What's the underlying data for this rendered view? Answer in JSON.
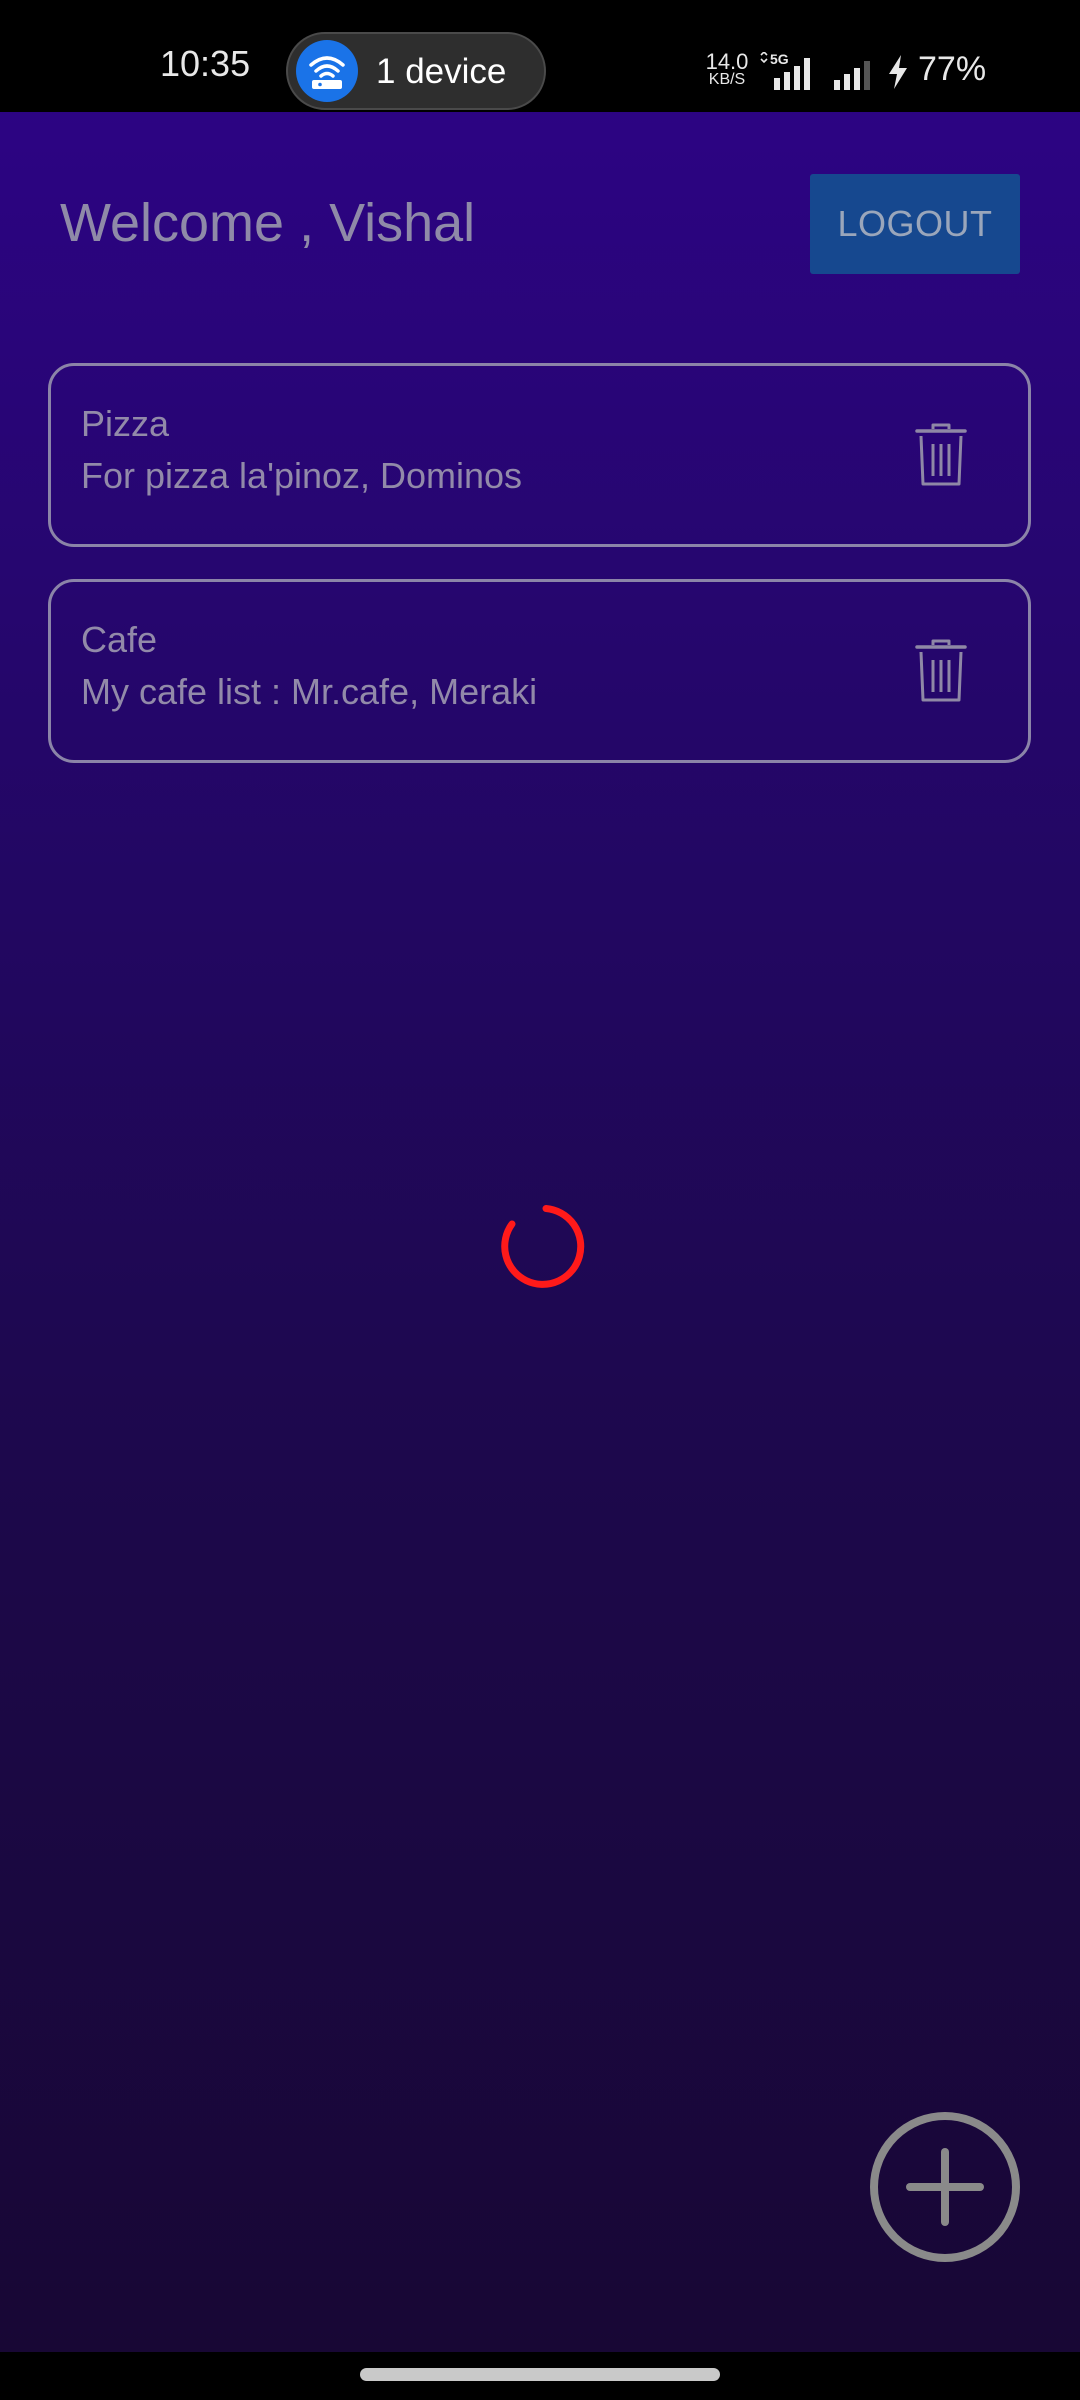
{
  "status_bar": {
    "time": "10:35",
    "hotspot_label": "1 device",
    "net_speed_value": "14.0",
    "net_speed_unit": "KB/S",
    "network_type": "5G",
    "battery": "77%",
    "icons": [
      "wifi-hotspot-icon",
      "signal-bars-icon",
      "charging-bolt-icon"
    ]
  },
  "header": {
    "welcome_text": "Welcome , Vishal",
    "logout_label": "LOGOUT"
  },
  "notes": [
    {
      "title": "Pizza",
      "description": "For pizza la'pinoz, Dominos",
      "action_icon": "trash-icon"
    },
    {
      "title": "Cafe",
      "description": "My cafe list : Mr.cafe, Meraki",
      "action_icon": "trash-icon"
    }
  ],
  "loading": {
    "spinner_color": "#ff1a1a"
  },
  "fab": {
    "icon": "plus-circle-icon"
  },
  "colors": {
    "background_top": "#2c0483",
    "background_bottom": "#180735",
    "logout_button": "#16488f",
    "text_muted": "#928aa9",
    "hotspot_accent": "#1a73e8"
  }
}
